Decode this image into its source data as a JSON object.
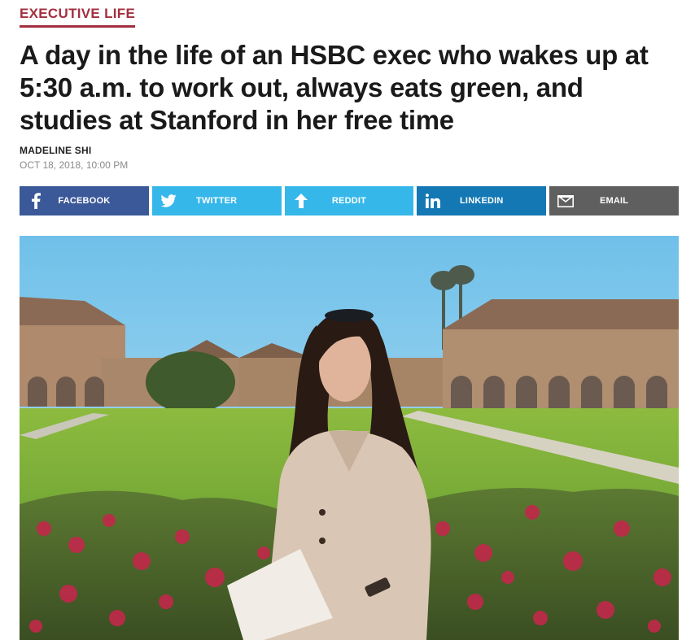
{
  "article": {
    "category": "EXECUTIVE LIFE",
    "headline": "A day in the life of an HSBC exec who wakes up at 5:30 a.m. to work out, always eats green, and studies at Stanford in her free time",
    "author": "MADELINE SHI",
    "timestamp": "OCT 18, 2018, 10:00 PM"
  },
  "share": {
    "facebook": {
      "label": "FACEBOOK",
      "icon": "facebook-icon",
      "color": "#3b5998"
    },
    "twitter": {
      "label": "TWITTER",
      "icon": "twitter-icon",
      "color": "#36b7ea"
    },
    "reddit": {
      "label": "REDDIT",
      "icon": "reddit-icon",
      "color": "#36b7ea"
    },
    "linkedin": {
      "label": "LINKEDIN",
      "icon": "linkedin-icon",
      "color": "#1478b4"
    },
    "email": {
      "label": "EMAIL",
      "icon": "email-icon",
      "color": "#5f5f5f"
    }
  },
  "colors": {
    "category_accent": "#a23040"
  }
}
